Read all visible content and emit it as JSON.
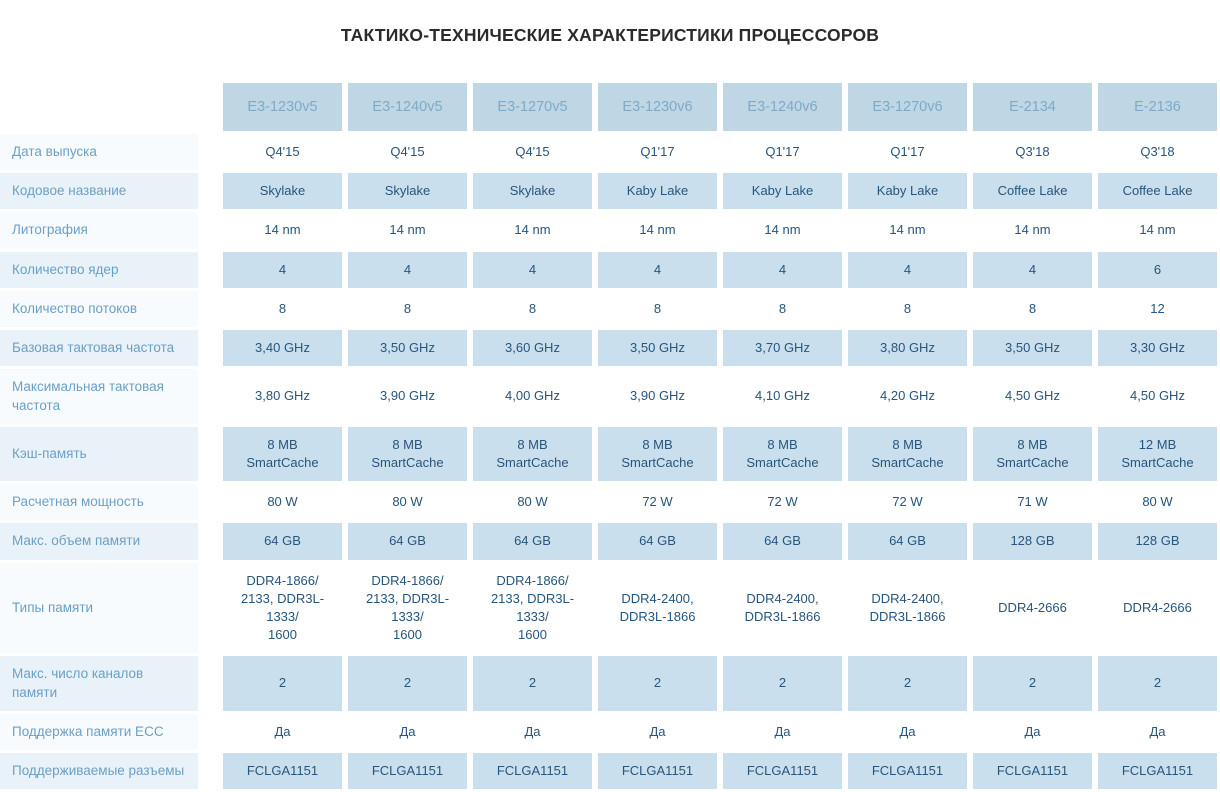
{
  "page": {
    "title": "ТАКТИКО-ТЕХНИЧЕСКИЕ ХАРАКТЕРИСТИКИ ПРОЦЕССОРОВ"
  },
  "colors": {
    "header_background": "#bfd7e5",
    "header_text": "#7fa9c6",
    "label_text": "#6ba0c6",
    "data_text": "#27557c",
    "row_alt_background": "#cadfed",
    "label_alt_background": "#e9f2f8",
    "title_text": "#2b2b2b"
  },
  "table": {
    "corner_label": "",
    "columns": [
      "E3-1230v5",
      "E3-1240v5",
      "E3-1270v5",
      "E3-1230v6",
      "E3-1240v6",
      "E3-1270v6",
      "E-2134",
      "E-2136"
    ],
    "rows": [
      {
        "label": "Дата выпуска",
        "values": [
          "Q4'15",
          "Q4'15",
          "Q4'15",
          "Q1'17",
          "Q1'17",
          "Q1'17",
          "Q3'18",
          "Q3'18"
        ]
      },
      {
        "label": "Кодовое название",
        "values": [
          "Skylake",
          "Skylake",
          "Skylake",
          "Kaby Lake",
          "Kaby Lake",
          "Kaby Lake",
          "Coffee Lake",
          "Coffee Lake"
        ]
      },
      {
        "label": "Литография",
        "values": [
          "14 nm",
          "14 nm",
          "14 nm",
          "14 nm",
          "14 nm",
          "14 nm",
          "14 nm",
          "14 nm"
        ]
      },
      {
        "label": "Количество ядер",
        "values": [
          "4",
          "4",
          "4",
          "4",
          "4",
          "4",
          "4",
          "6"
        ]
      },
      {
        "label": "Количество потоков",
        "values": [
          "8",
          "8",
          "8",
          "8",
          "8",
          "8",
          "8",
          "12"
        ]
      },
      {
        "label": "Базовая тактовая частота",
        "values": [
          "3,40 GHz",
          "3,50 GHz",
          "3,60 GHz",
          "3,50 GHz",
          "3,70 GHz",
          "3,80 GHz",
          "3,50 GHz",
          "3,30 GHz"
        ]
      },
      {
        "label": "Максимальная тактовая частота",
        "values": [
          "3,80 GHz",
          "3,90 GHz",
          "4,00 GHz",
          "3,90 GHz",
          "4,10 GHz",
          "4,20 GHz",
          "4,50 GHz",
          "4,50 GHz"
        ]
      },
      {
        "label": "Кэш-память",
        "values": [
          "8 MB\nSmartCache",
          "8 MB\nSmartCache",
          "8 MB\nSmartCache",
          "8 MB\nSmartCache",
          "8 MB\nSmartCache",
          "8 MB\nSmartCache",
          "8 MB\nSmartCache",
          "12 MB\nSmartCache"
        ]
      },
      {
        "label": "Расчетная мощность",
        "values": [
          "80 W",
          "80 W",
          "80 W",
          "72 W",
          "72 W",
          "72 W",
          "71 W",
          "80 W"
        ]
      },
      {
        "label": "Макс. объем памяти",
        "values": [
          "64 GB",
          "64 GB",
          "64 GB",
          "64 GB",
          "64 GB",
          "64 GB",
          "128 GB",
          "128 GB"
        ]
      },
      {
        "label": "Типы памяти",
        "values": [
          "DDR4-1866/\n2133, DDR3L-1333/\n1600",
          "DDR4-1866/\n2133, DDR3L-1333/\n1600",
          "DDR4-1866/\n2133, DDR3L-1333/\n1600",
          "DDR4-2400,\nDDR3L-1866",
          "DDR4-2400,\nDDR3L-1866",
          "DDR4-2400,\nDDR3L-1866",
          "DDR4-2666",
          "DDR4-2666"
        ]
      },
      {
        "label": "Макс. число каналов памяти",
        "values": [
          "2",
          "2",
          "2",
          "2",
          "2",
          "2",
          "2",
          "2"
        ]
      },
      {
        "label": "Поддержка памяти ECC",
        "values": [
          "Да",
          "Да",
          "Да",
          "Да",
          "Да",
          "Да",
          "Да",
          "Да"
        ]
      },
      {
        "label": "Поддерживаемые разъемы",
        "values": [
          "FCLGA1151",
          "FCLGA1151",
          "FCLGA1151",
          "FCLGA1151",
          "FCLGA1151",
          "FCLGA1151",
          "FCLGA1151",
          "FCLGA1151"
        ]
      }
    ]
  }
}
